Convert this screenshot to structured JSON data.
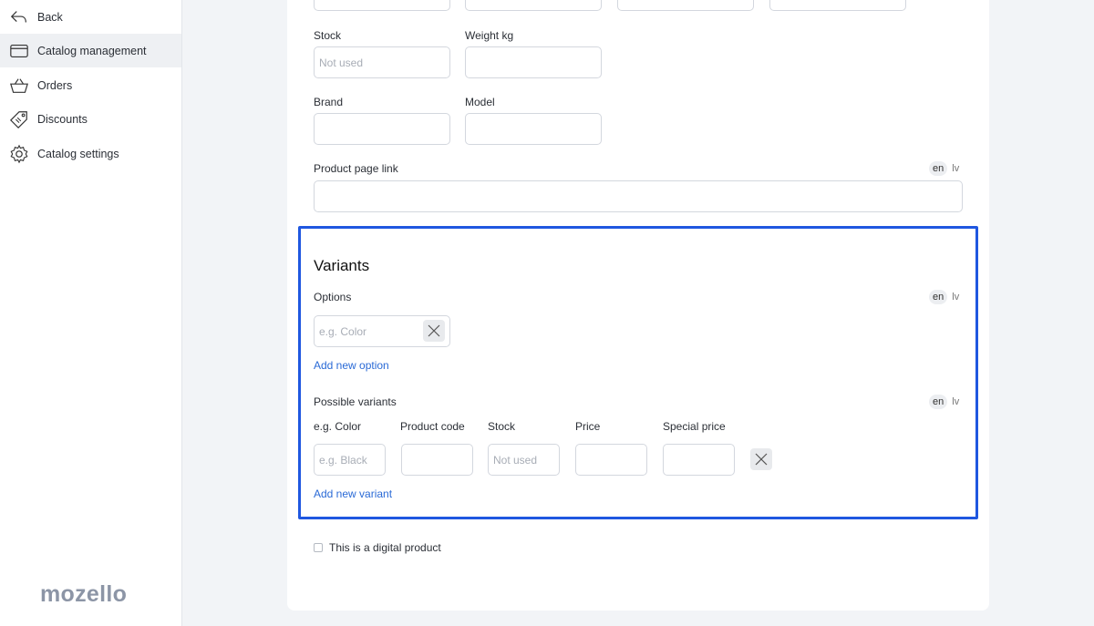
{
  "sidebar": {
    "items": [
      {
        "label": "Back",
        "icon": "back-arrow-icon"
      },
      {
        "label": "Catalog management",
        "icon": "folder-icon"
      },
      {
        "label": "Orders",
        "icon": "basket-icon"
      },
      {
        "label": "Discounts",
        "icon": "tag-icon"
      },
      {
        "label": "Catalog settings",
        "icon": "gear-icon"
      }
    ],
    "logo": "mozello"
  },
  "form": {
    "stock_label": "Stock",
    "stock_placeholder": "Not used",
    "weight_label": "Weight kg",
    "brand_label": "Brand",
    "model_label": "Model",
    "product_link_label": "Product page link",
    "lang_en": "en",
    "lang_lv": "lv"
  },
  "variants": {
    "title": "Variants",
    "options_label": "Options",
    "option_placeholder": "e.g. Color",
    "add_option": "Add new option",
    "possible_label": "Possible variants",
    "columns": [
      "e.g. Color",
      "Product code",
      "Stock",
      "Price",
      "Special price"
    ],
    "row_color_placeholder": "e.g. Black",
    "row_stock_placeholder": "Not used",
    "add_variant": "Add new variant"
  },
  "digital": {
    "label": "This is a digital product",
    "checked": false
  },
  "colors": {
    "accent": "#1f57e0",
    "link": "#2a6ad6",
    "logo": "#8c95a6"
  }
}
